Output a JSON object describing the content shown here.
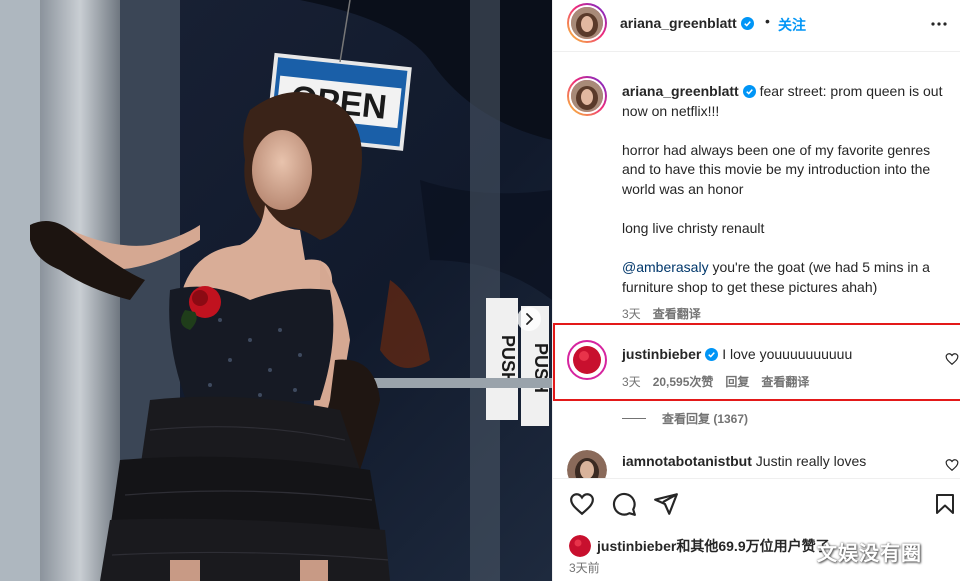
{
  "post": {
    "author": "ariana_greenblatt",
    "follow_label": "关注",
    "separator": "•"
  },
  "caption": {
    "author": "ariana_greenblatt",
    "line1": "fear street: prom queen is out now on netflix!!!",
    "para2": "horror had always been one of my favorite genres and to have this movie be my introduction into the world was an honor",
    "para3": "long live christy renault",
    "mention": "@amberasaly",
    "para4_rest": " you're the goat (we had 5 mins in a furniture shop to get these pictures ahah)",
    "time": "3天",
    "translate": "查看翻译"
  },
  "comments": [
    {
      "author": "justinbieber",
      "text": "I love youuuuuuuuuu",
      "time": "3天",
      "likes": "20,595次赞",
      "reply": "回复",
      "translate": "查看翻译",
      "view_replies": "查看回复 (1367)"
    },
    {
      "author": "iamnotabotanistbut",
      "text": "Justin really loves"
    }
  ],
  "likes_line": {
    "user": "justinbieber",
    "rest": "和其他69.9万位用户赞了"
  },
  "timestamp": "3天前",
  "photo": {
    "sign_open": "OPEN",
    "sign_push_left": "PUSH",
    "sign_push_right": "PUSH"
  },
  "watermark": "文娱没有圈",
  "icons": [
    "verified-badge-icon",
    "more-options-icon",
    "heart-icon",
    "comment-icon",
    "share-icon",
    "bookmark-icon",
    "chevron-right-icon"
  ],
  "colors": {
    "accent_blue": "#0095f6",
    "highlight_red": "#e31919",
    "mention_blue": "#00376b",
    "verified": "#0095f6"
  }
}
